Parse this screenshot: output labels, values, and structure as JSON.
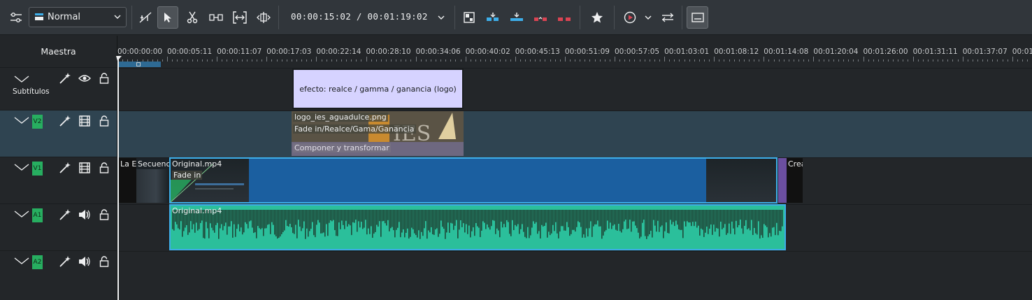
{
  "toolbar": {
    "edit_mode": "Normal",
    "timecode": "00:00:15:02 / 00:01:19:02"
  },
  "headers": {
    "master_label": "Maestra",
    "tracks": [
      {
        "id": "subtitles",
        "label": "Subtítulos",
        "tag": ""
      },
      {
        "id": "v2",
        "label": "",
        "tag": "V2"
      },
      {
        "id": "v1",
        "label": "",
        "tag": "V1"
      },
      {
        "id": "a1",
        "label": "",
        "tag": "A1"
      },
      {
        "id": "a2",
        "label": "",
        "tag": "A2"
      }
    ]
  },
  "ruler": {
    "labels": [
      "00:00:00:00",
      "00:00:05:11",
      "00:00:11:07",
      "00:00:17:03",
      "00:00:22:14",
      "00:00:28:10",
      "00:00:34:06",
      "00:00:40:02",
      "00:00:45:13",
      "00:00:51:09",
      "00:00:57:05",
      "00:01:03:01",
      "00:01:08:12",
      "00:01:14:08",
      "00:01:20:04",
      "00:01:26:00",
      "00:01:31:11",
      "00:01:37:07",
      "00:01:4"
    ]
  },
  "clips": {
    "subtitle_effect": "efecto: realce / gamma / ganancia (logo)",
    "v2_logo_name": "logo_ies_aguadulce.png",
    "v2_logo_effects": "Fade in/Realce/Gama/Ganancia",
    "v2_logo_transition": "Componer y transformar",
    "v1_clip_a": "La E",
    "v1_clip_b": "Secuenc",
    "v1_original": "Original.mp4",
    "v1_fade": "Fade in",
    "v1_clip_end": "Crea",
    "a1_original": "Original.mp4"
  },
  "colors": {
    "accent_blue": "#3daee9",
    "video_clip": "#1b5fa0",
    "audio_clip": "#2bbf9b",
    "audio_wave": "#1e4a3a",
    "subtitle_clip": "#d6d3ff",
    "track_tag": "#27ae60"
  },
  "icons": [
    "settings-sliders-icon",
    "edit-mode-icon",
    "razor-spacer-icon",
    "select-pointer-icon",
    "cut-scissors-icon",
    "spacer-icon",
    "ripple-icon",
    "slip-icon",
    "timecode-chevron-icon",
    "multitrack-icon",
    "insert-icon",
    "overwrite-icon",
    "lift-icon",
    "extract-icon",
    "favorite-star-icon",
    "play-preview-icon",
    "mix-icon",
    "subtitle-icon"
  ]
}
